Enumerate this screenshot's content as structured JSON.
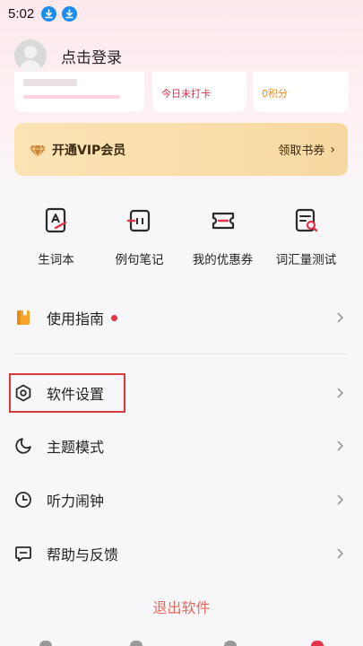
{
  "status_bar": {
    "time": "5:02"
  },
  "profile": {
    "login_text": "点击登录"
  },
  "stats": {
    "checkin": "今日未打卡",
    "points": "0积分"
  },
  "vip": {
    "label": "开通VIP会员",
    "action": "领取书券",
    "chevron": "›"
  },
  "quick_actions": [
    {
      "label": "生词本",
      "icon": "vocab-book-icon"
    },
    {
      "label": "例句笔记",
      "icon": "sentence-note-icon"
    },
    {
      "label": "我的优惠券",
      "icon": "coupon-icon"
    },
    {
      "label": "词汇量测试",
      "icon": "vocab-test-icon"
    }
  ],
  "menu": [
    {
      "label": "使用指南",
      "icon": "guide-book-icon",
      "badge": true
    },
    {
      "label": "软件设置",
      "icon": "settings-icon"
    },
    {
      "label": "主题模式",
      "icon": "moon-icon"
    },
    {
      "label": "听力闹钟",
      "icon": "clock-icon"
    },
    {
      "label": "帮助与反馈",
      "icon": "feedback-icon"
    }
  ],
  "logout": "退出软件",
  "colors": {
    "accent_red": "#e5334b",
    "logout": "#e46a5c",
    "vip_gold": "#f8d8a1",
    "highlight": "#d93a3a"
  }
}
